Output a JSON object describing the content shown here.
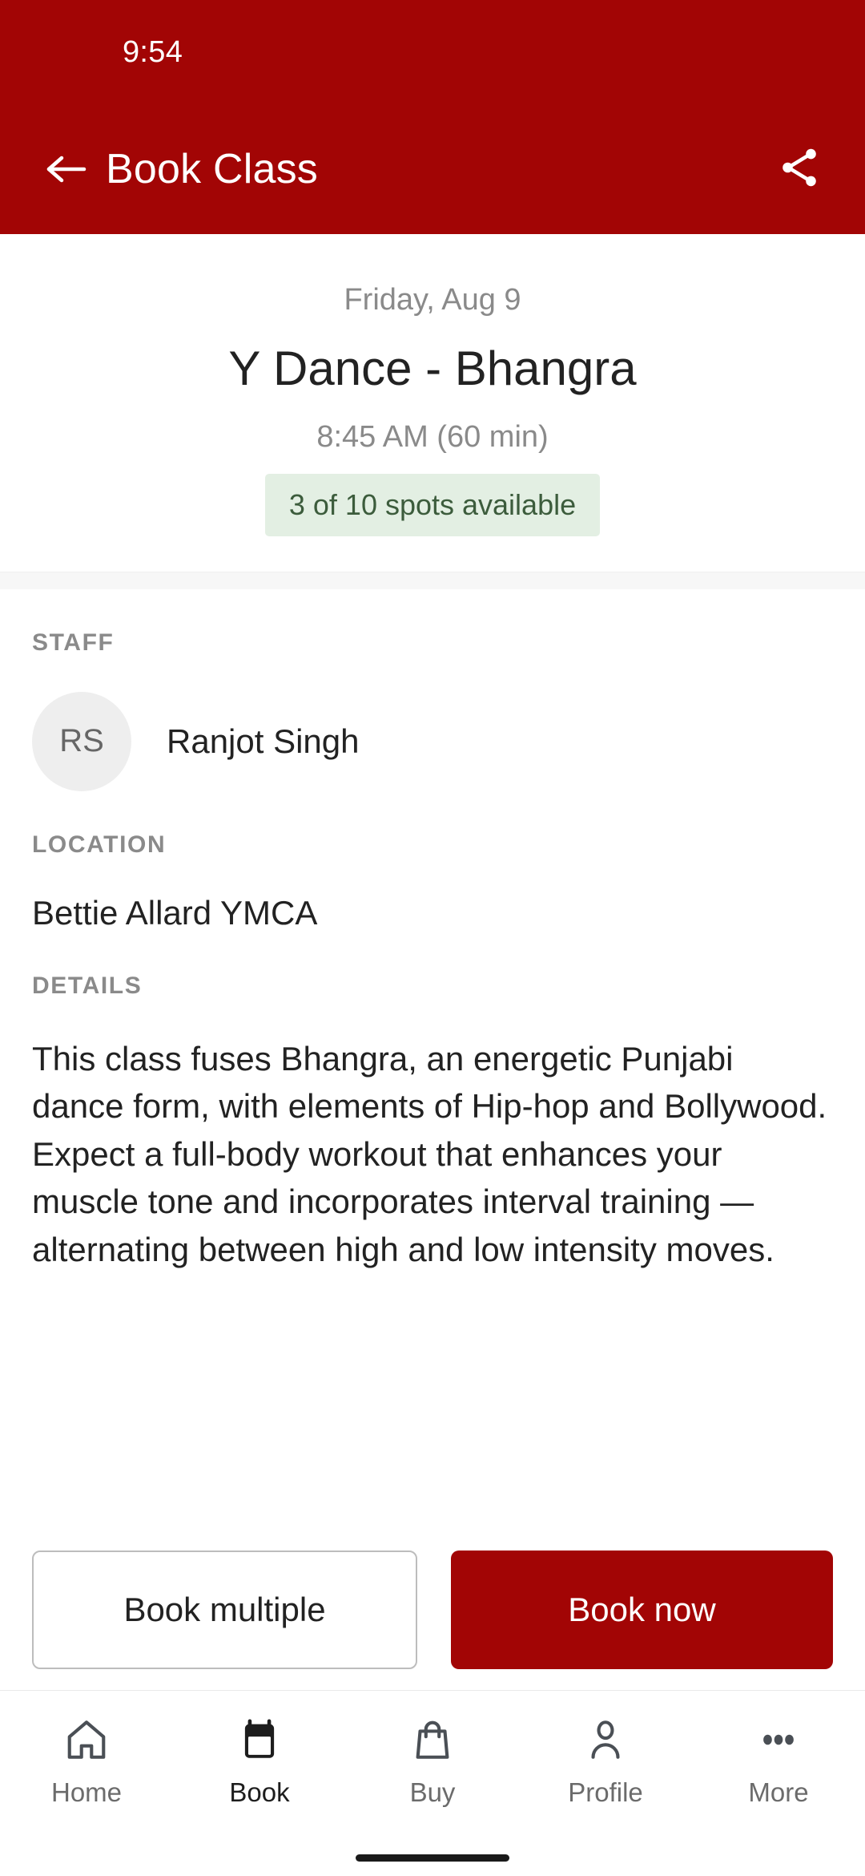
{
  "status_bar": {
    "time": "9:54"
  },
  "header": {
    "title": "Book Class",
    "back_icon": "arrow-left-icon",
    "share_icon": "share-icon",
    "background_color": "#a20505"
  },
  "hero": {
    "date": "Friday, Aug 9",
    "class_title": "Y Dance - Bhangra",
    "time": "8:45 AM (60 min)",
    "spots_badge": "3 of 10 spots available",
    "badge_bg_color": "#e3efe3",
    "badge_text_color": "#3c5c3c"
  },
  "sections": {
    "staff": {
      "label": "STAFF",
      "avatar_initials": "RS",
      "name": "Ranjot Singh"
    },
    "location": {
      "label": "LOCATION",
      "value": "Bettie Allard YMCA"
    },
    "details": {
      "label": "DETAILS",
      "text": "This class fuses Bhangra, an energetic Punjabi dance form, with elements of Hip-hop and Bollywood. Expect a full-body workout that enhances your muscle tone and incorporates interval training — alternating between high and low intensity moves."
    }
  },
  "actions": {
    "secondary_label": "Book multiple",
    "primary_label": "Book now",
    "primary_color": "#a20505"
  },
  "bottom_nav": {
    "items": [
      {
        "label": "Home",
        "icon": "home-icon",
        "active": false
      },
      {
        "label": "Book",
        "icon": "calendar-icon",
        "active": true
      },
      {
        "label": "Buy",
        "icon": "bag-icon",
        "active": false
      },
      {
        "label": "Profile",
        "icon": "person-icon",
        "active": false
      },
      {
        "label": "More",
        "icon": "dots-icon",
        "active": false
      }
    ]
  }
}
